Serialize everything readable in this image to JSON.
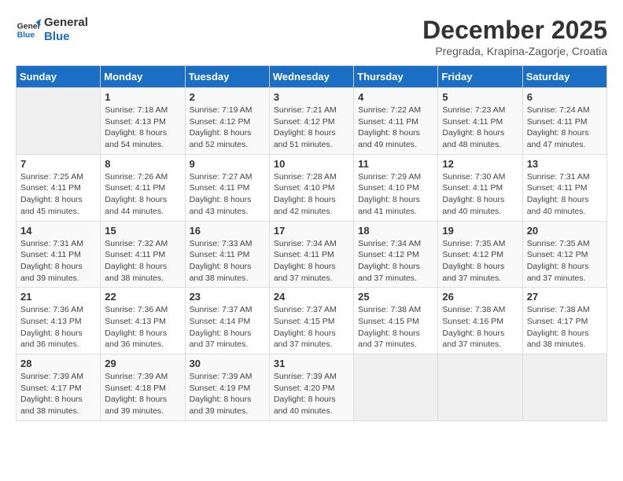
{
  "logo": {
    "text_general": "General",
    "text_blue": "Blue"
  },
  "title": "December 2025",
  "subtitle": "Pregrada, Krapina-Zagorje, Croatia",
  "headers": [
    "Sunday",
    "Monday",
    "Tuesday",
    "Wednesday",
    "Thursday",
    "Friday",
    "Saturday"
  ],
  "weeks": [
    [
      {
        "day": "",
        "info": ""
      },
      {
        "day": "1",
        "info": "Sunrise: 7:18 AM\nSunset: 4:13 PM\nDaylight: 8 hours\nand 54 minutes."
      },
      {
        "day": "2",
        "info": "Sunrise: 7:19 AM\nSunset: 4:12 PM\nDaylight: 8 hours\nand 52 minutes."
      },
      {
        "day": "3",
        "info": "Sunrise: 7:21 AM\nSunset: 4:12 PM\nDaylight: 8 hours\nand 51 minutes."
      },
      {
        "day": "4",
        "info": "Sunrise: 7:22 AM\nSunset: 4:11 PM\nDaylight: 8 hours\nand 49 minutes."
      },
      {
        "day": "5",
        "info": "Sunrise: 7:23 AM\nSunset: 4:11 PM\nDaylight: 8 hours\nand 48 minutes."
      },
      {
        "day": "6",
        "info": "Sunrise: 7:24 AM\nSunset: 4:11 PM\nDaylight: 8 hours\nand 47 minutes."
      }
    ],
    [
      {
        "day": "7",
        "info": "Sunrise: 7:25 AM\nSunset: 4:11 PM\nDaylight: 8 hours\nand 45 minutes."
      },
      {
        "day": "8",
        "info": "Sunrise: 7:26 AM\nSunset: 4:11 PM\nDaylight: 8 hours\nand 44 minutes."
      },
      {
        "day": "9",
        "info": "Sunrise: 7:27 AM\nSunset: 4:11 PM\nDaylight: 8 hours\nand 43 minutes."
      },
      {
        "day": "10",
        "info": "Sunrise: 7:28 AM\nSunset: 4:10 PM\nDaylight: 8 hours\nand 42 minutes."
      },
      {
        "day": "11",
        "info": "Sunrise: 7:29 AM\nSunset: 4:10 PM\nDaylight: 8 hours\nand 41 minutes."
      },
      {
        "day": "12",
        "info": "Sunrise: 7:30 AM\nSunset: 4:11 PM\nDaylight: 8 hours\nand 40 minutes."
      },
      {
        "day": "13",
        "info": "Sunrise: 7:31 AM\nSunset: 4:11 PM\nDaylight: 8 hours\nand 40 minutes."
      }
    ],
    [
      {
        "day": "14",
        "info": "Sunrise: 7:31 AM\nSunset: 4:11 PM\nDaylight: 8 hours\nand 39 minutes."
      },
      {
        "day": "15",
        "info": "Sunrise: 7:32 AM\nSunset: 4:11 PM\nDaylight: 8 hours\nand 38 minutes."
      },
      {
        "day": "16",
        "info": "Sunrise: 7:33 AM\nSunset: 4:11 PM\nDaylight: 8 hours\nand 38 minutes."
      },
      {
        "day": "17",
        "info": "Sunrise: 7:34 AM\nSunset: 4:11 PM\nDaylight: 8 hours\nand 37 minutes."
      },
      {
        "day": "18",
        "info": "Sunrise: 7:34 AM\nSunset: 4:12 PM\nDaylight: 8 hours\nand 37 minutes."
      },
      {
        "day": "19",
        "info": "Sunrise: 7:35 AM\nSunset: 4:12 PM\nDaylight: 8 hours\nand 37 minutes."
      },
      {
        "day": "20",
        "info": "Sunrise: 7:35 AM\nSunset: 4:12 PM\nDaylight: 8 hours\nand 37 minutes."
      }
    ],
    [
      {
        "day": "21",
        "info": "Sunrise: 7:36 AM\nSunset: 4:13 PM\nDaylight: 8 hours\nand 36 minutes."
      },
      {
        "day": "22",
        "info": "Sunrise: 7:36 AM\nSunset: 4:13 PM\nDaylight: 8 hours\nand 36 minutes."
      },
      {
        "day": "23",
        "info": "Sunrise: 7:37 AM\nSunset: 4:14 PM\nDaylight: 8 hours\nand 37 minutes."
      },
      {
        "day": "24",
        "info": "Sunrise: 7:37 AM\nSunset: 4:15 PM\nDaylight: 8 hours\nand 37 minutes."
      },
      {
        "day": "25",
        "info": "Sunrise: 7:38 AM\nSunset: 4:15 PM\nDaylight: 8 hours\nand 37 minutes."
      },
      {
        "day": "26",
        "info": "Sunrise: 7:38 AM\nSunset: 4:16 PM\nDaylight: 8 hours\nand 37 minutes."
      },
      {
        "day": "27",
        "info": "Sunrise: 7:38 AM\nSunset: 4:17 PM\nDaylight: 8 hours\nand 38 minutes."
      }
    ],
    [
      {
        "day": "28",
        "info": "Sunrise: 7:39 AM\nSunset: 4:17 PM\nDaylight: 8 hours\nand 38 minutes."
      },
      {
        "day": "29",
        "info": "Sunrise: 7:39 AM\nSunset: 4:18 PM\nDaylight: 8 hours\nand 39 minutes."
      },
      {
        "day": "30",
        "info": "Sunrise: 7:39 AM\nSunset: 4:19 PM\nDaylight: 8 hours\nand 39 minutes."
      },
      {
        "day": "31",
        "info": "Sunrise: 7:39 AM\nSunset: 4:20 PM\nDaylight: 8 hours\nand 40 minutes."
      },
      {
        "day": "",
        "info": ""
      },
      {
        "day": "",
        "info": ""
      },
      {
        "day": "",
        "info": ""
      }
    ]
  ]
}
